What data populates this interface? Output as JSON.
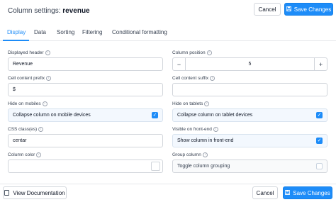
{
  "header": {
    "title_prefix": "Column settings:",
    "title_column": "revenue",
    "cancel_label": "Cancel",
    "save_label": "Save Changes"
  },
  "tabs": [
    {
      "label": "Display",
      "active": true
    },
    {
      "label": "Data",
      "active": false
    },
    {
      "label": "Sorting",
      "active": false
    },
    {
      "label": "Filtering",
      "active": false
    },
    {
      "label": "Conditional formatting",
      "active": false
    }
  ],
  "form": {
    "displayed_header": {
      "label": "Displayed header",
      "value": "Revenue"
    },
    "column_position": {
      "label": "Column position",
      "value": "5"
    },
    "cell_prefix": {
      "label": "Cell content prefix",
      "value": "$"
    },
    "cell_suffix": {
      "label": "Cell content suffix",
      "value": ""
    },
    "hide_mobiles": {
      "label": "Hide on mobiles",
      "text": "Collapse column on mobile devices",
      "checked": true
    },
    "hide_tablets": {
      "label": "Hide on tablets",
      "text": "Collapse column on tablet devices",
      "checked": true
    },
    "css_class": {
      "label": "CSS class(es)",
      "value": "centar"
    },
    "visible_frontend": {
      "label": "Visible on front-end",
      "text": "Show column in front-end",
      "checked": true
    },
    "column_color": {
      "label": "Column color",
      "value": "#ffffff"
    },
    "group_column": {
      "label": "Group column",
      "text": "Toggle column grouping",
      "checked": false
    }
  },
  "footer": {
    "doc_label": "View Documentation",
    "cancel_label": "Cancel",
    "save_label": "Save Changes"
  },
  "colors": {
    "accent": "#1d8cf8",
    "border": "#d1d5db"
  },
  "icons": {
    "info": "info-icon",
    "save": "save-icon",
    "doc": "document-icon",
    "check": "checkmark-icon"
  }
}
